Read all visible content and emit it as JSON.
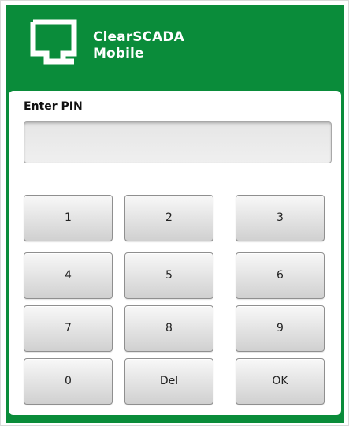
{
  "app": {
    "title_line1": "ClearSCADA",
    "title_line2": "Mobile",
    "logo_icon": "clearscada-logo-icon",
    "header_color": "#0a8c3a"
  },
  "pin": {
    "label": "Enter PIN",
    "value": "",
    "placeholder": ""
  },
  "keypad": {
    "keys": [
      "1",
      "2",
      "3",
      "4",
      "5",
      "6",
      "7",
      "8",
      "9",
      "0",
      "Del",
      "OK"
    ]
  }
}
